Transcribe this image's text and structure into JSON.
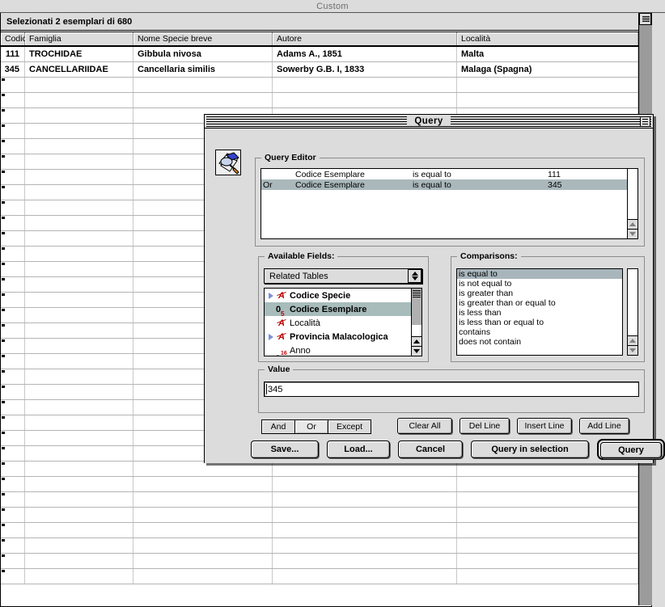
{
  "app": {
    "window_title": "Custom",
    "status_text": "Selezionati 2 esemplari di 680"
  },
  "table": {
    "columns": [
      "Codice",
      "Famiglia",
      "Nome Specie breve",
      "Autore",
      "Località"
    ],
    "rows": [
      [
        "111",
        "TROCHIDAE",
        "Gibbula nivosa",
        "Adams A., 1851",
        "Malta"
      ],
      [
        "345",
        "CANCELLARIIDAE",
        "Cancellaria similis",
        "Sowerby G.B. I, 1833",
        "Malaga (Spagna)"
      ]
    ],
    "empty_row_count": 33
  },
  "dialog": {
    "title": "Query",
    "icon": "query-magnifier-icon",
    "close_box": "close-box-icon",
    "editor": {
      "legend": "Query Editor",
      "columns": [
        "operator",
        "field",
        "comparison",
        "value"
      ],
      "lines": [
        {
          "operator": "",
          "field": "Codice Esemplare",
          "comparison": "is equal to",
          "value": "111",
          "selected": false
        },
        {
          "operator": "Or",
          "field": "Codice Esemplare",
          "comparison": "is equal to",
          "value": "345",
          "selected": true
        }
      ]
    },
    "available_fields": {
      "legend": "Available Fields:",
      "popup_selected": "Related Tables",
      "popup_icon": "up-down-arrows-icon",
      "items": [
        {
          "label": "Codice Specie",
          "icon": "text-field-icon",
          "expandable": true,
          "bold": true,
          "selected": false
        },
        {
          "label": "Codice Esemplare",
          "icon": "number-05-icon",
          "expandable": false,
          "bold": true,
          "selected": true
        },
        {
          "label": "Località",
          "icon": "text-field-icon",
          "expandable": false,
          "bold": false,
          "selected": false
        },
        {
          "label": "Provincia Malacologica",
          "icon": "text-field-icon",
          "expandable": true,
          "bold": true,
          "selected": false
        },
        {
          "label": "Anno",
          "icon": "number-216-icon",
          "expandable": false,
          "bold": false,
          "selected": false
        }
      ]
    },
    "comparisons": {
      "legend": "Comparisons:",
      "items": [
        {
          "label": "is equal to",
          "selected": true
        },
        {
          "label": "is not equal to",
          "selected": false
        },
        {
          "label": "is greater than",
          "selected": false
        },
        {
          "label": "is greater than or equal to",
          "selected": false
        },
        {
          "label": "is less than",
          "selected": false
        },
        {
          "label": "is less than or equal to",
          "selected": false
        },
        {
          "label": "contains",
          "selected": false
        },
        {
          "label": "does not contain",
          "selected": false
        }
      ]
    },
    "value": {
      "legend": "Value",
      "text": "345"
    },
    "operator_buttons": [
      {
        "label": "And",
        "active": false
      },
      {
        "label": "Or",
        "active": true
      },
      {
        "label": "Except",
        "active": false
      }
    ],
    "line_buttons": [
      "Clear All",
      "Del Line",
      "Insert Line",
      "Add Line"
    ],
    "action_buttons": [
      {
        "label": "Save...",
        "default": false
      },
      {
        "label": "Load...",
        "default": false
      },
      {
        "label": "Cancel",
        "default": false
      },
      {
        "label": "Query in selection",
        "default": false
      },
      {
        "label": "Query",
        "default": true
      }
    ]
  },
  "colors": {
    "window_bg": "#dcdcdc",
    "selection": "#a8b6bc",
    "field_icon_red": "#bb0000",
    "disclosure_blue": "#7b8fd4",
    "scroll_thumb": "#9b9b9b"
  }
}
